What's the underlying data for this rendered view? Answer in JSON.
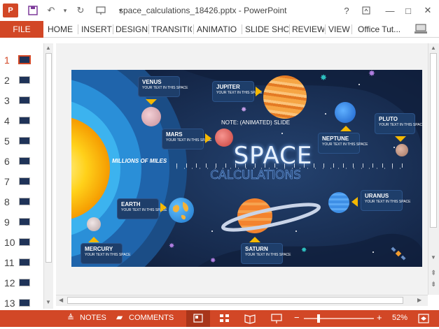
{
  "window": {
    "title": "space_calculations_18426.pptx - PowerPoint"
  },
  "quick_access": {
    "app_icon": "powerpoint-icon",
    "save": "save-icon",
    "undo": "undo-icon",
    "redo": "redo-icon",
    "present": "present-icon",
    "customize": "customize-icon"
  },
  "window_controls": {
    "help": "?",
    "ribbon_options": "ribbon-options-icon",
    "minimize": "—",
    "maximize": "□",
    "close": "✕"
  },
  "ribbon": {
    "file": "FILE",
    "tabs": [
      "HOME",
      "INSERT",
      "DESIGN",
      "TRANSITIO",
      "ANIMATIO",
      "SLIDE SHO",
      "REVIEW",
      "VIEW",
      "Office Tut..."
    ]
  },
  "thumbnails": {
    "numbers": [
      "1",
      "2",
      "3",
      "4",
      "5",
      "6",
      "7",
      "8",
      "9",
      "10",
      "11",
      "12",
      "13"
    ],
    "active": "1"
  },
  "slide": {
    "title": "SPACE",
    "subtitle": "CALCULATIONS",
    "note": "NOTE: (ANIMATED) SLIDE",
    "axis_label": "MILLIONS OF MILES",
    "placeholder": "YOUR TEXT IN THIS SPACE",
    "planets": {
      "venus": "VENUS",
      "mars": "MARS",
      "jupiter": "JUPITER",
      "neptune": "NEPTUNE",
      "pluto": "PLUTO",
      "earth": "EARTH",
      "mercury": "MERCURY",
      "saturn": "SATURN",
      "uranus": "URANUS"
    }
  },
  "statusbar": {
    "notes": "NOTES",
    "comments": "COMMENTS",
    "zoom": "52%"
  },
  "colors": {
    "accent": "#d24726",
    "slide_bg": "#15284a",
    "arrow": "#f5b800",
    "box": "#1e3e6a"
  }
}
